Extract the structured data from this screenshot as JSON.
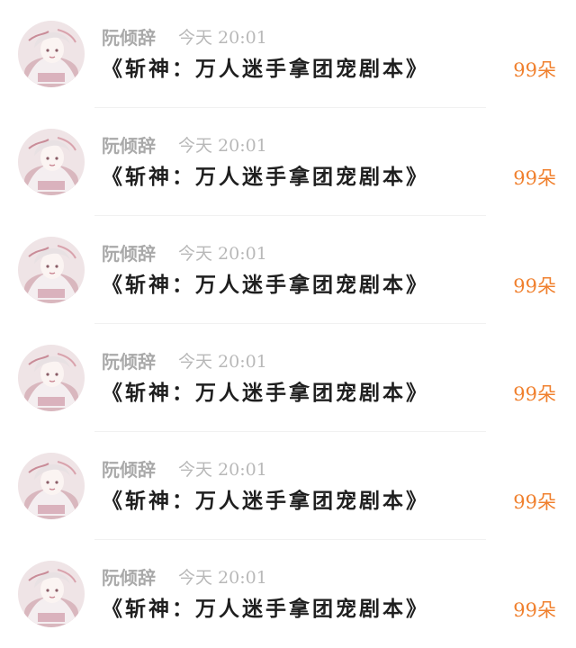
{
  "colors": {
    "username": "#a9a9a9",
    "time": "#b8b8b8",
    "gift_text": "#1f1f1f",
    "count": "#f0802e",
    "divider": "#f1f1f1"
  },
  "items": [
    {
      "username": "阮倾辞",
      "time": "今天 20:01",
      "text": "《斩神：万人迷手拿团宠剧本》",
      "count": "99朵",
      "avatar_icon": "avatar-illustration"
    },
    {
      "username": "阮倾辞",
      "time": "今天 20:01",
      "text": "《斩神：万人迷手拿团宠剧本》",
      "count": "99朵",
      "avatar_icon": "avatar-illustration"
    },
    {
      "username": "阮倾辞",
      "time": "今天 20:01",
      "text": "《斩神：万人迷手拿团宠剧本》",
      "count": "99朵",
      "avatar_icon": "avatar-illustration"
    },
    {
      "username": "阮倾辞",
      "time": "今天 20:01",
      "text": "《斩神：万人迷手拿团宠剧本》",
      "count": "99朵",
      "avatar_icon": "avatar-illustration"
    },
    {
      "username": "阮倾辞",
      "time": "今天 20:01",
      "text": "《斩神：万人迷手拿团宠剧本》",
      "count": "99朵",
      "avatar_icon": "avatar-illustration"
    },
    {
      "username": "阮倾辞",
      "time": "今天 20:01",
      "text": "《斩神：万人迷手拿团宠剧本》",
      "count": "99朵",
      "avatar_icon": "avatar-illustration"
    }
  ]
}
